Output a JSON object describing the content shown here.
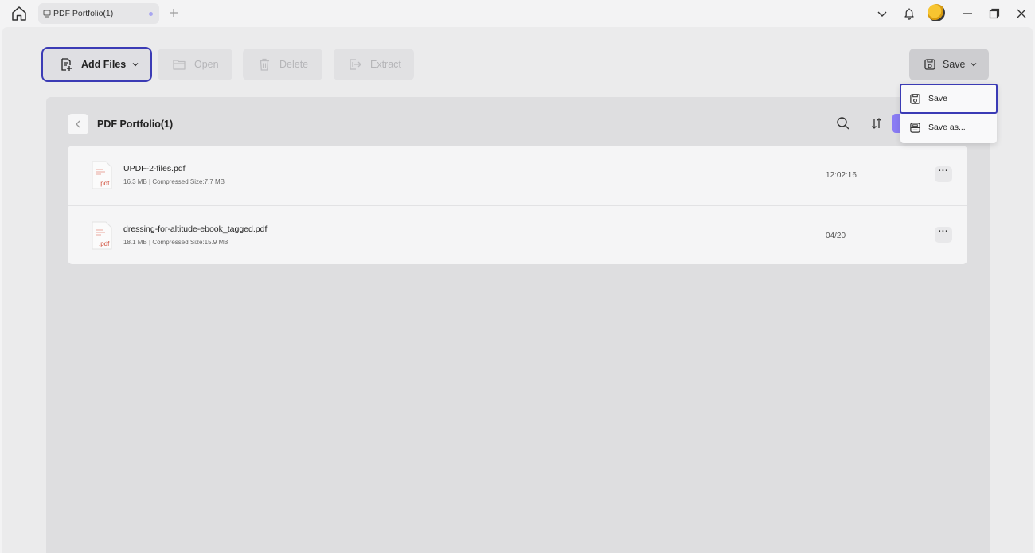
{
  "titlebar": {
    "tab_label": "PDF Portfolio(1)",
    "icons": [
      "home-icon",
      "document-icon",
      "plus-icon",
      "chevron-down-icon",
      "bell-icon",
      "minimize-icon",
      "restore-icon",
      "close-icon"
    ]
  },
  "toolbar": {
    "add_files_label": "Add Files",
    "open_label": "Open",
    "delete_label": "Delete",
    "extract_label": "Extract",
    "save_label": "Save"
  },
  "panel": {
    "title": "PDF Portfolio(1)"
  },
  "files": [
    {
      "name": "UPDF-2-files.pdf",
      "meta": "16.3 MB | Compressed Size:7.7 MB",
      "date": "12:02:16",
      "ext": ".pdf",
      "more": "···"
    },
    {
      "name": "dressing-for-altitude-ebook_tagged.pdf",
      "meta": "18.1 MB | Compressed Size:15.9 MB",
      "date": "04/20",
      "ext": ".pdf",
      "more": "···"
    }
  ],
  "save_menu": {
    "items": [
      {
        "label": "Save",
        "icon": "save-icon"
      },
      {
        "label": "Save as...",
        "icon": "save-as-icon"
      }
    ]
  },
  "colors": {
    "accent_outline": "#3b3bb5",
    "view_toggle": "#8a7cf4",
    "pdf_red": "#d0503c"
  }
}
